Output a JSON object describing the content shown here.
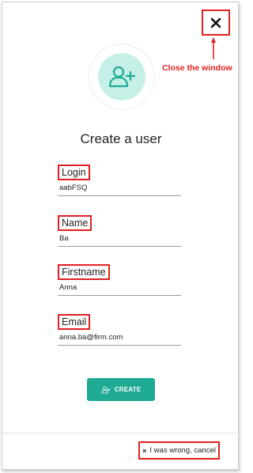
{
  "header": {
    "close_icon": "close-icon",
    "annotation": "Close the window"
  },
  "avatar": {
    "icon": "user-plus-icon",
    "accent": "#1faa94",
    "bg": "#c6efe8"
  },
  "form": {
    "title": "Create a user",
    "fields": [
      {
        "label": "Login",
        "value": "aabFSQ"
      },
      {
        "label": "Name",
        "value": "Ba"
      },
      {
        "label": "Firstname",
        "value": "Anna"
      },
      {
        "label": "Email",
        "value": "anna.ba@firm.com"
      }
    ],
    "create_label": "CREATE"
  },
  "footer": {
    "cancel_icon": "×",
    "cancel_label": "I was wrong, cancel"
  },
  "colors": {
    "annotation_red": "#e02020",
    "button": "#1faa94"
  }
}
